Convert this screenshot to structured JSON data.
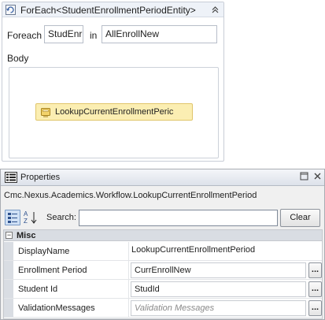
{
  "designer": {
    "foreach_title": "ForEach<StudentEnrollmentPeriodEntity>",
    "foreach_label": "Foreach",
    "item_variable": "StudEnr",
    "in_label": "in",
    "collection_value": "AllEnrollNew",
    "body_label": "Body",
    "child_activity": "LookupCurrentEnrollmentPeric"
  },
  "properties": {
    "title": "Properties",
    "object_name": "Cmc.Nexus.Academics.Workflow.LookupCurrentEnrollmentPeriod",
    "search_label": "Search:",
    "search_value": "",
    "clear_label": "Clear",
    "ellipsis_label": "...",
    "category": {
      "toggle": "−",
      "label": "Misc"
    },
    "rows": [
      {
        "name": "DisplayName",
        "value": "LookupCurrentEnrollmentPeriod"
      },
      {
        "name": "Enrollment Period",
        "value": "CurrEnrollNew"
      },
      {
        "name": "Student Id",
        "value": "StudId"
      },
      {
        "name": "ValidationMessages",
        "value": "Validation Messages"
      }
    ]
  },
  "colors": {
    "activity_fill": "#fbeeb2",
    "header_fill": "#eef2f8",
    "category_fill": "#d9dde3"
  }
}
